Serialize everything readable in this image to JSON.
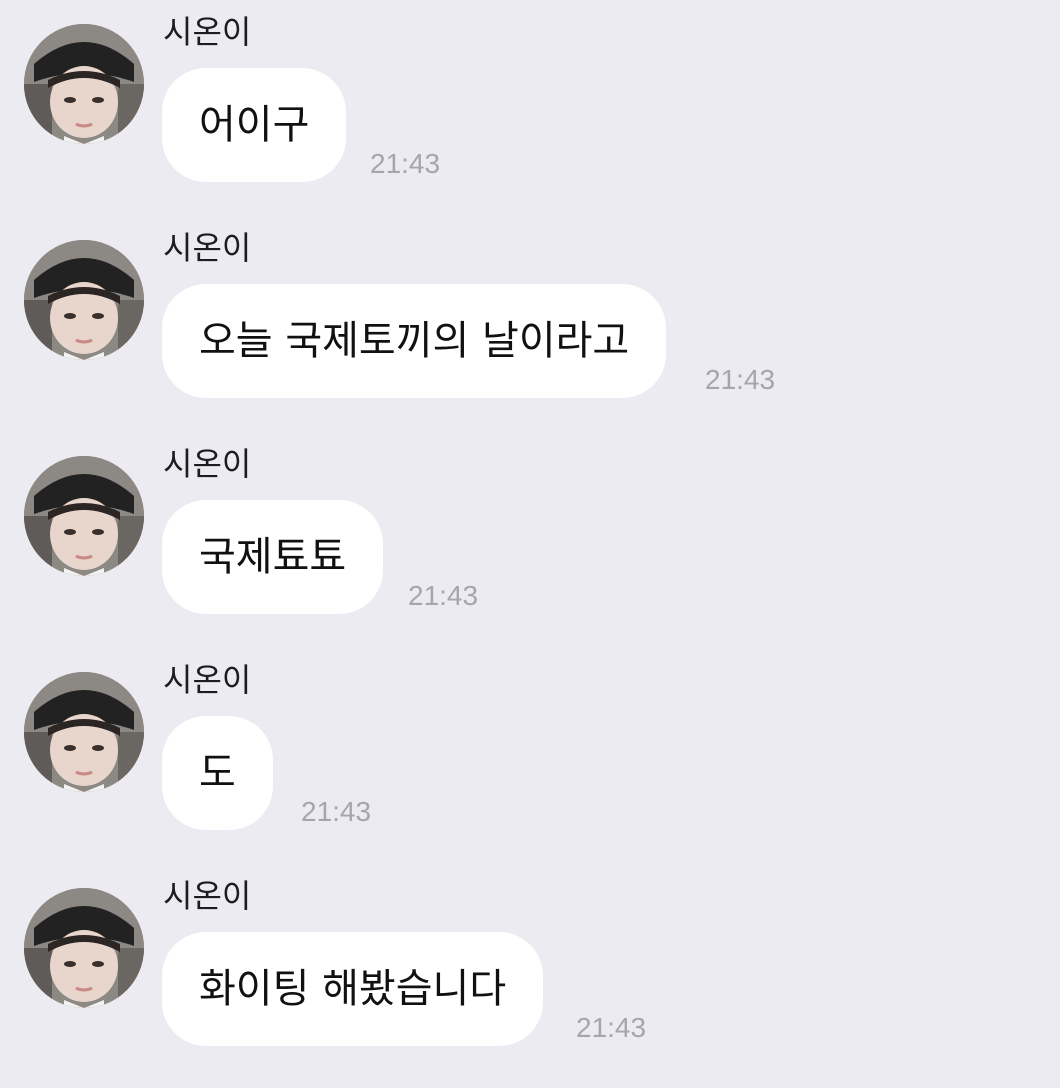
{
  "messages": [
    {
      "sender": "시온이",
      "text": "어이구",
      "time": "21:43"
    },
    {
      "sender": "시온이",
      "text": "오늘 국제토끼의 날이라고",
      "time": "21:43"
    },
    {
      "sender": "시온이",
      "text": "국제툐툐",
      "time": "21:43"
    },
    {
      "sender": "시온이",
      "text": "도",
      "time": "21:43"
    },
    {
      "sender": "시온이",
      "text": "화이팅 해봤습니다",
      "time": "21:43"
    }
  ],
  "colors": {
    "background": "#edebf2",
    "bubble": "#ffffff",
    "time": "#a7a4ab"
  },
  "icons": {
    "avatar": "profile-photo"
  }
}
